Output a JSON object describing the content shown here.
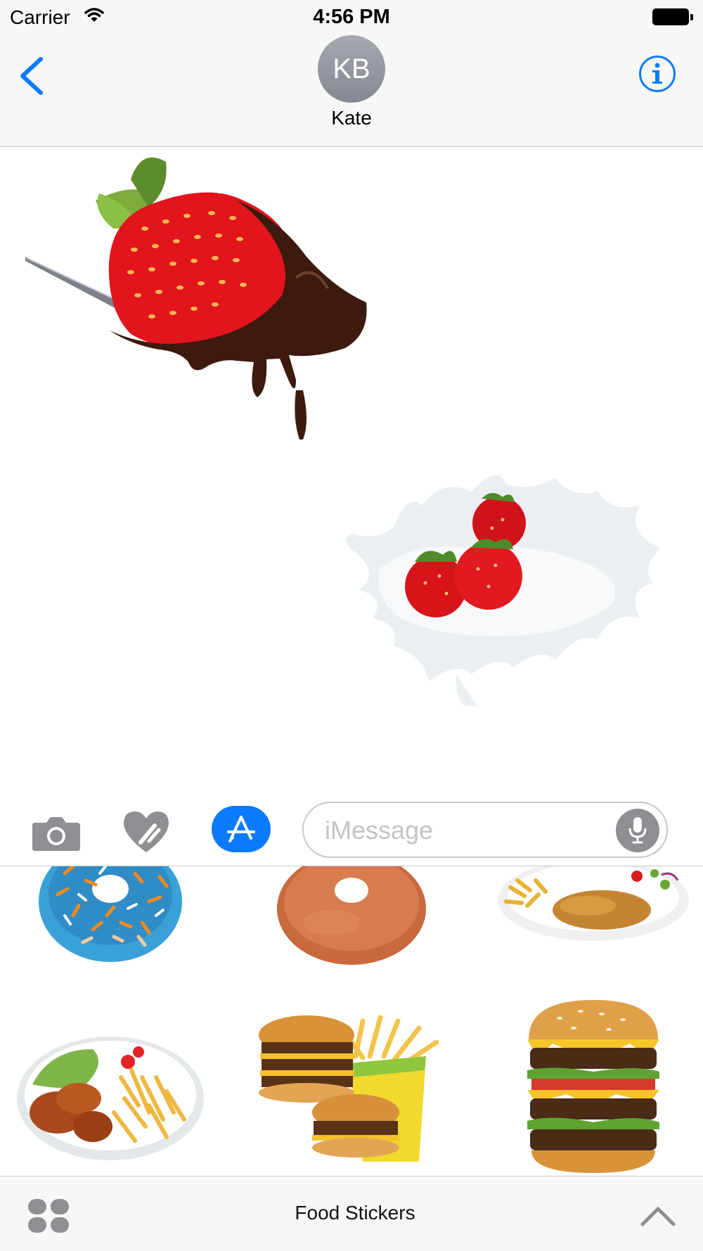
{
  "status_bar": {
    "carrier": "Carrier",
    "time": "4:56 PM"
  },
  "nav": {
    "avatar_initials": "KB",
    "contact_name": "Kate"
  },
  "conversation": {
    "stickers": [
      {
        "name": "Chocolate-dipped strawberry on spoon"
      },
      {
        "name": "Strawberries in milk splash"
      }
    ]
  },
  "input": {
    "placeholder": "iMessage",
    "value": ""
  },
  "drawer": {
    "title": "Food Stickers",
    "stickers": [
      "Sprinkled donut",
      "Glazed donut",
      "Schnitzel with fries and salad",
      "Chicken with fries plate",
      "Burgers and fries",
      "Double cheeseburger"
    ]
  },
  "colors": {
    "accent": "#0a7aff",
    "bar_background": "#f7f7f7",
    "separator": "#c8c7cc"
  },
  "icons": [
    "back-chevron-icon",
    "info-icon",
    "camera-icon",
    "digital-touch-heart-icon",
    "app-store-icon",
    "microphone-icon",
    "app-grid-icon",
    "chevron-up-icon"
  ]
}
